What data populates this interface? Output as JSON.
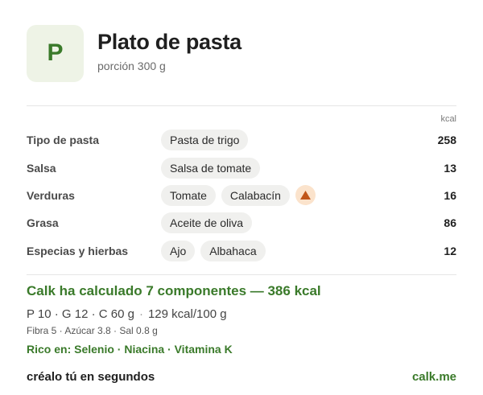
{
  "header": {
    "avatar_letter": "P",
    "title": "Plato de pasta",
    "subtitle": "porción 300 g"
  },
  "table": {
    "unit_header": "kcal",
    "rows": [
      {
        "label": "Tipo de pasta",
        "chips": [
          "Pasta de trigo"
        ],
        "kcal": "258"
      },
      {
        "label": "Salsa",
        "chips": [
          "Salsa de tomate"
        ],
        "kcal": "13"
      },
      {
        "label": "Verduras",
        "chips": [
          "Tomate",
          "Calabacín"
        ],
        "warning_icon": "warning-triangle-icon",
        "kcal": "16"
      },
      {
        "label": "Grasa",
        "chips": [
          "Aceite de oliva"
        ],
        "kcal": "86"
      },
      {
        "label": "Especias y hierbas",
        "chips": [
          "Ajo",
          "Albahaca"
        ],
        "kcal": "12"
      }
    ]
  },
  "summary": {
    "title": "Calk ha calculado 7 componentes — 386 kcal",
    "macros_main": "P 10 · G 12 · C 60 g",
    "macros_sep": "·",
    "macros_density": "129 kcal/100 g",
    "minor": "Fibra 5 · Azúcar 3.8 · Sal 0.8 g",
    "rich_in": "Rico en: Selenio · Niacina · Vitamina K"
  },
  "footer": {
    "cta": "créalo tú en segundos",
    "link": "calk.me"
  },
  "colors": {
    "accent_green": "#3a7a2a",
    "avatar_bg": "#eef3e6",
    "chip_bg": "#f0f0ee",
    "warning_bg": "#fbe3cc",
    "warning_fg": "#c0561a"
  }
}
